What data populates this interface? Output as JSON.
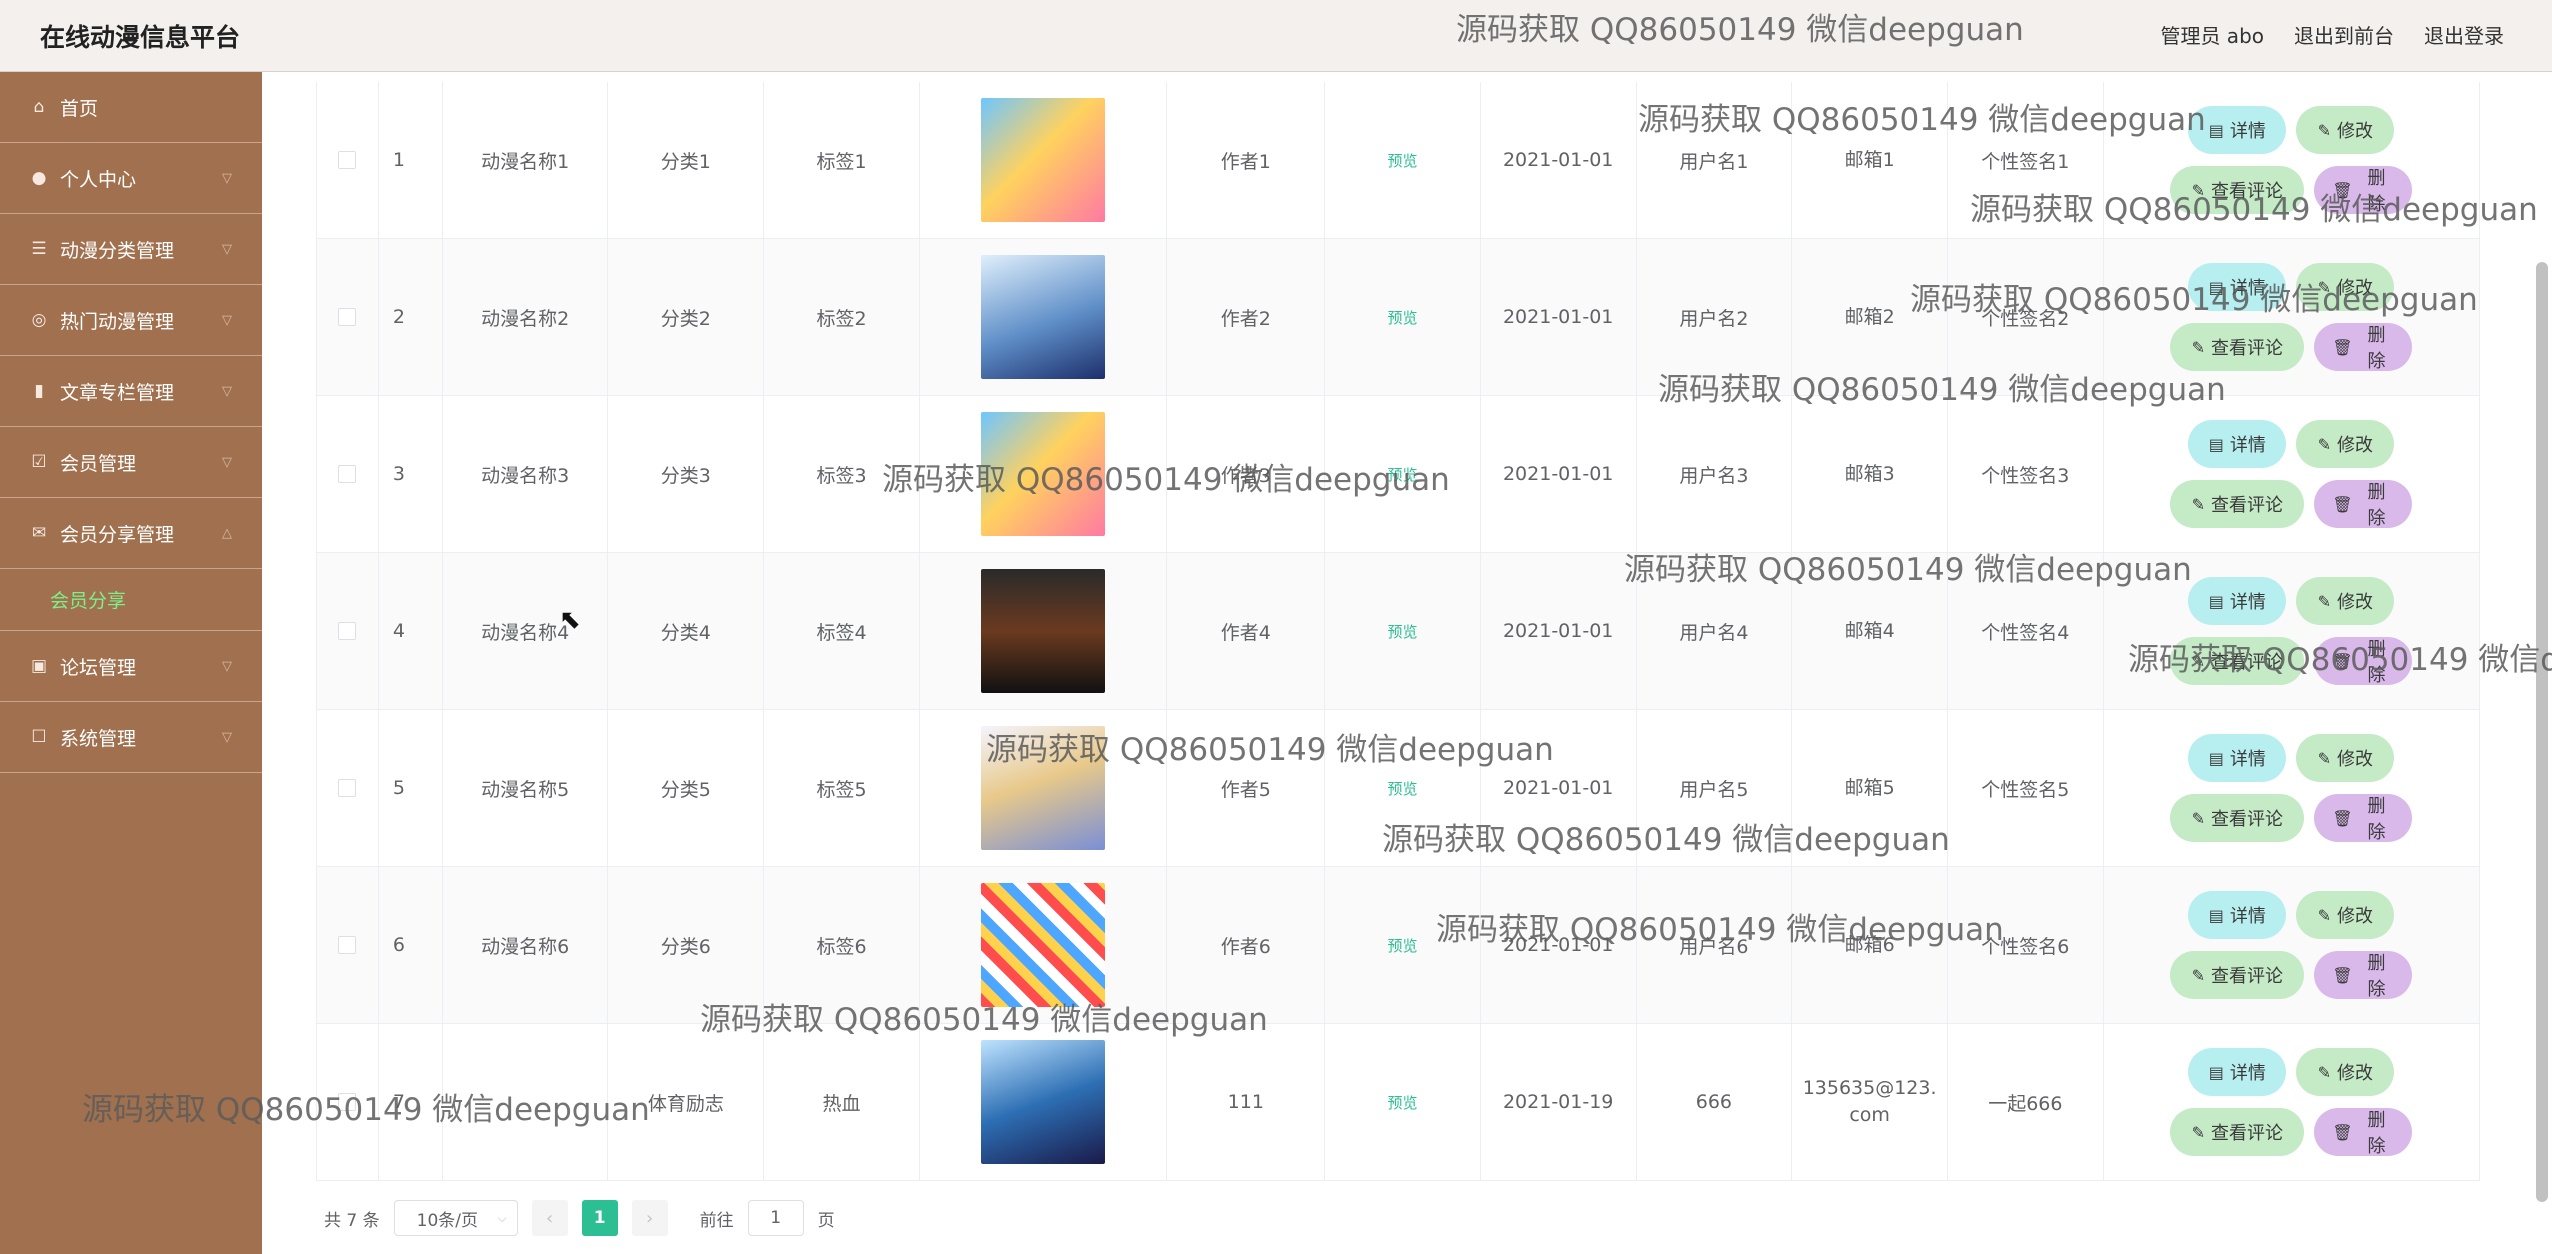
{
  "header": {
    "app_title": "在线动漫信息平台",
    "user_label": "管理员 abo",
    "to_front_label": "退出到前台",
    "logout_label": "退出登录"
  },
  "sidebar": {
    "items": [
      {
        "label": "首页",
        "icon": "home-icon"
      },
      {
        "label": "个人中心",
        "icon": "user-icon"
      },
      {
        "label": "动漫分类管理",
        "icon": "list-icon"
      },
      {
        "label": "热门动漫管理",
        "icon": "fire-icon"
      },
      {
        "label": "文章专栏管理",
        "icon": "chart-icon"
      },
      {
        "label": "会员管理",
        "icon": "check-icon"
      },
      {
        "label": "会员分享管理",
        "icon": "mail-icon"
      },
      {
        "label": "论坛管理",
        "icon": "forum-icon"
      },
      {
        "label": "系统管理",
        "icon": "settings-icon"
      }
    ],
    "active_sub": "会员分享"
  },
  "table": {
    "preview_label": "预览",
    "detail_label": "详情",
    "edit_label": "修改",
    "comment_label": "查看评论",
    "delete_label": "删除",
    "rows": [
      {
        "idx": "1",
        "name": "动漫名称1",
        "cat": "分类1",
        "tag": "标签1",
        "author": "作者1",
        "date": "2021-01-01",
        "user": "用户名1",
        "mail": "邮箱1",
        "sig": "个性签名1"
      },
      {
        "idx": "2",
        "name": "动漫名称2",
        "cat": "分类2",
        "tag": "标签2",
        "author": "作者2",
        "date": "2021-01-01",
        "user": "用户名2",
        "mail": "邮箱2",
        "sig": "个性签名2"
      },
      {
        "idx": "3",
        "name": "动漫名称3",
        "cat": "分类3",
        "tag": "标签3",
        "author": "作者3",
        "date": "2021-01-01",
        "user": "用户名3",
        "mail": "邮箱3",
        "sig": "个性签名3"
      },
      {
        "idx": "4",
        "name": "动漫名称4",
        "cat": "分类4",
        "tag": "标签4",
        "author": "作者4",
        "date": "2021-01-01",
        "user": "用户名4",
        "mail": "邮箱4",
        "sig": "个性签名4"
      },
      {
        "idx": "5",
        "name": "动漫名称5",
        "cat": "分类5",
        "tag": "标签5",
        "author": "作者5",
        "date": "2021-01-01",
        "user": "用户名5",
        "mail": "邮箱5",
        "sig": "个性签名5"
      },
      {
        "idx": "6",
        "name": "动漫名称6",
        "cat": "分类6",
        "tag": "标签6",
        "author": "作者6",
        "date": "2021-01-01",
        "user": "用户名6",
        "mail": "邮箱6",
        "sig": "个性签名6"
      },
      {
        "idx": "7",
        "name": "",
        "cat": "体育励志",
        "tag": "热血",
        "author": "111",
        "date": "2021-01-19",
        "user": "666",
        "mail": "135635@123.com",
        "sig": "一起666"
      }
    ]
  },
  "pagination": {
    "total": "共 7 条",
    "page_size": "10条/页",
    "current_page": "1",
    "goto_prefix": "前往",
    "goto_value": "1",
    "goto_suffix": "页"
  },
  "watermark": "源码获取 QQ86050149 微信deepguan",
  "colors": {
    "sidebar": "#a0704f",
    "accent": "#2bbf93",
    "active_sub": "#7ef08a"
  }
}
